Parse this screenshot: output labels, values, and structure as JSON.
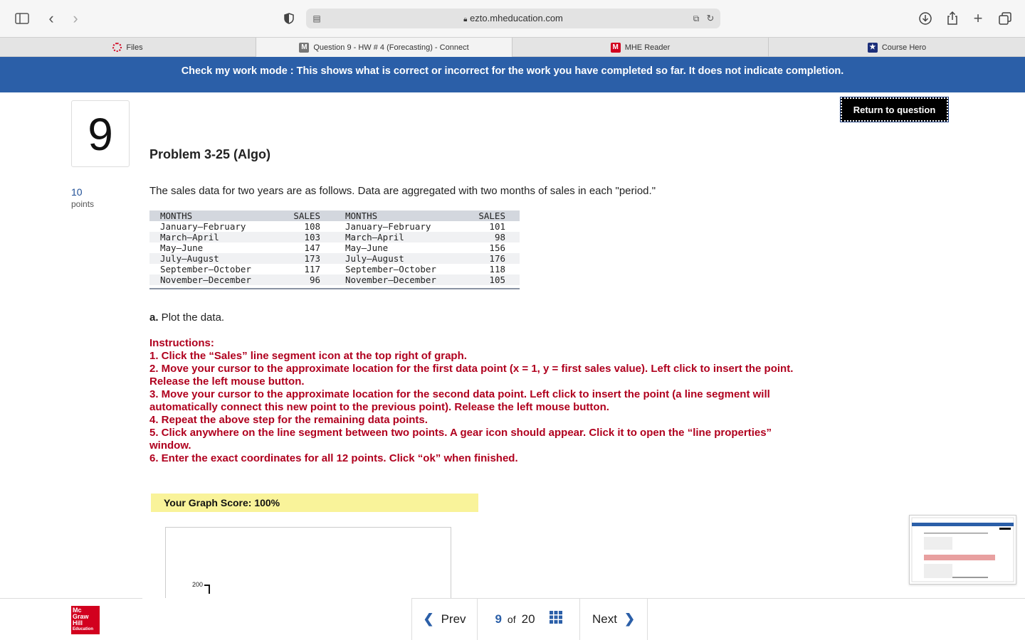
{
  "browser": {
    "url": "ezto.mheducation.com",
    "tabs": [
      {
        "label": "Files",
        "icon": "files-icon"
      },
      {
        "label": "Question 9 - HW # 4 (Forecasting) - Connect",
        "icon": "m-icon"
      },
      {
        "label": "MHE Reader",
        "icon": "mhe-icon"
      },
      {
        "label": "Course Hero",
        "icon": "star-icon"
      }
    ]
  },
  "banner": "Check my work mode : This shows what is correct or incorrect for the work you have completed so far. It does not indicate completion.",
  "question": {
    "number": "9",
    "title": "Problem 3-25 (Algo)",
    "points": "10",
    "points_label": "points",
    "return_label": "Return to question",
    "intro": "The sales data for two years are as follows. Data are aggregated with two months of sales in each \"period.\""
  },
  "table": {
    "headers": [
      "MONTHS",
      "SALES",
      "MONTHS",
      "SALES"
    ],
    "rows": [
      [
        "January–February",
        "108",
        "January–February",
        "101"
      ],
      [
        "March–April",
        "103",
        "March–April",
        "98"
      ],
      [
        "May–June",
        "147",
        "May–June",
        "156"
      ],
      [
        "July–August",
        "173",
        "July–August",
        "176"
      ],
      [
        "September–October",
        "117",
        "September–October",
        "118"
      ],
      [
        "November–December",
        "96",
        "November–December",
        "105"
      ]
    ]
  },
  "part_a": {
    "label": "a.",
    "text": " Plot the data."
  },
  "instructions": [
    "Instructions:",
    "1. Click the “Sales” line segment icon at the top right of graph.",
    "2. Move your cursor to the approximate location for the first data point (x = 1, y = first sales value). Left click to insert the point. Release the left mouse button.",
    "3. Move your cursor to the approximate location for the second data point. Left click to insert the point (a line segment will automatically connect this new point to the previous point). Release the left mouse button.",
    "4. Repeat the above step for the remaining data points.",
    "5. Click anywhere on the line segment between two points. A gear icon should appear. Click it to open the “line properties” window.",
    "6. Enter the exact coordinates for all 12 points. Click “ok” when finished."
  ],
  "score": "Your Graph Score: 100%",
  "graph": {
    "y_tick": "200"
  },
  "footer": {
    "logo_lines": [
      "Mc",
      "Graw",
      "Hill",
      "Education"
    ],
    "prev": "Prev",
    "next": "Next",
    "current": "9",
    "of": "of",
    "total": "20"
  },
  "colors": {
    "banner": "#2b5fa8",
    "instructions": "#b0001e",
    "score_bg": "#f9f39a",
    "logo": "#d2001e"
  }
}
